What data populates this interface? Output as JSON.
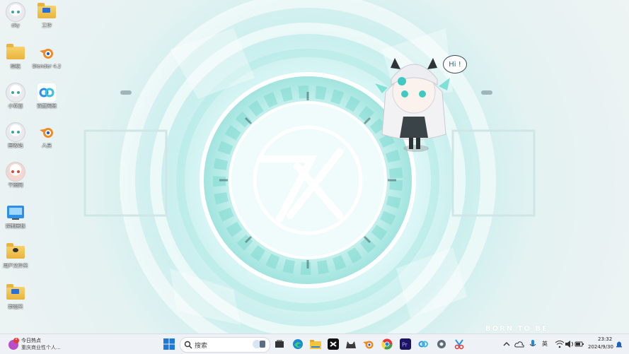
{
  "desktop": {
    "icons": [
      {
        "label": "sky",
        "kind": "avatar"
      },
      {
        "label": "工作",
        "kind": "folder"
      },
      {
        "label": "壁纸",
        "kind": "folder"
      },
      {
        "label": "Blender 4.2",
        "kind": "blender"
      },
      {
        "label": "小欢喜",
        "kind": "avatar"
      },
      {
        "label": "百度网盘",
        "kind": "baidu"
      },
      {
        "label": "回收站",
        "kind": "avatar"
      },
      {
        "label": "人员",
        "kind": "blender"
      },
      {
        "label": "千图网",
        "kind": "avatar"
      },
      {
        "label": "控制面板",
        "kind": "panel"
      },
      {
        "label": "用户文件夹",
        "kind": "folder"
      },
      {
        "label": "新建夹",
        "kind": "folder"
      }
    ],
    "speech_bubble": "Hi !",
    "brand_text": "BORN TO BE",
    "logo_text": "7X"
  },
  "taskbar": {
    "news_title": "今日热点",
    "news_subtitle": "重庆商业性个人...",
    "news_badge": "1",
    "search_placeholder": "搜索",
    "apps": [
      "windows-start",
      "search",
      "task-view",
      "edge",
      "file-explorer",
      "capcut",
      "clash",
      "blender",
      "chrome",
      "premiere-pro",
      "baidu-netdisk",
      "settings",
      "snipping-tool"
    ],
    "tray": {
      "ime": "英",
      "time": "23:32",
      "date": "2024/9/30"
    }
  },
  "colors": {
    "accent_teal": "#3fc9c0",
    "taskbar_bg": "#eef2f6"
  }
}
